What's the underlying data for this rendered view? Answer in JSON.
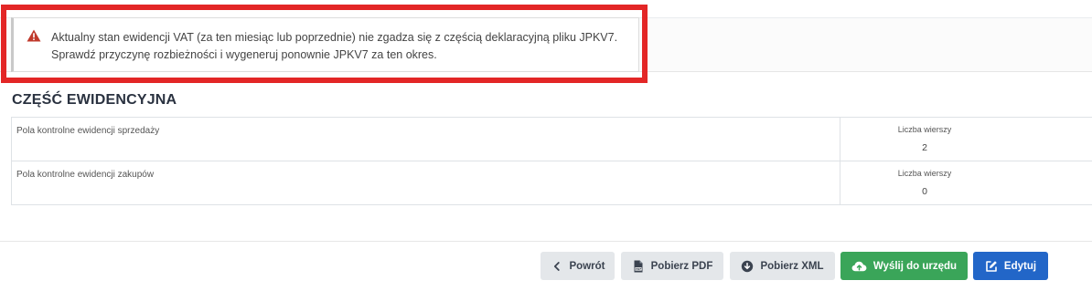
{
  "alert": {
    "icon": "warning-triangle-icon",
    "line1": "Aktualny stan ewidencji VAT (za ten miesiąc lub poprzednie) nie zgadza się z częścią deklaracyjną pliku JPKV7.",
    "line2": "Sprawdź przyczynę rozbieżności i wygeneruj ponownie JPKV7 za ten okres."
  },
  "section": {
    "title": "CZĘŚĆ EWIDENCYJNA"
  },
  "rows": [
    {
      "label": "Pola kontrolne ewidencji sprzedaży",
      "count_header": "Liczba wierszy",
      "count": "2"
    },
    {
      "label": "Pola kontrolne ewidencji zakupów",
      "count_header": "Liczba wierszy",
      "count": "0"
    }
  ],
  "footer": {
    "back_label": "Powrót",
    "pdf_label": "Pobierz PDF",
    "xml_label": "Pobierz XML",
    "send_label": "Wyślij do urzędu",
    "edit_label": "Edytuj"
  },
  "colors": {
    "highlight": "#e32626",
    "warning": "#c0392b",
    "send_button": "#3aa559",
    "edit_button": "#2266c8",
    "secondary_button": "#e4e7ea"
  }
}
